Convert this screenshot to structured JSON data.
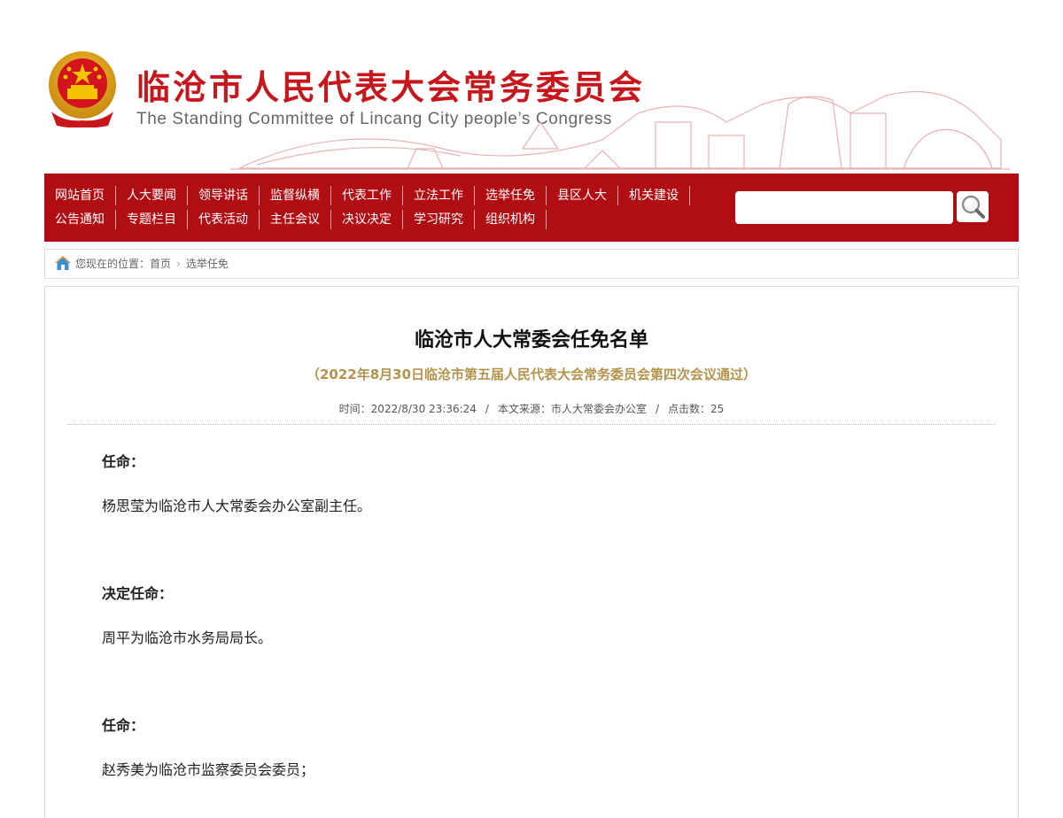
{
  "header": {
    "title_cn": "临沧市人民代表大会常务委员会",
    "title_en": "The Standing Committee of Lincang City people’s Congress",
    "emblem_icon": "national-emblem-icon"
  },
  "colors": {
    "brand_red": "#b10e14",
    "subtitle_gold": "#b3934a"
  },
  "nav": {
    "row1": [
      "网站首页",
      "人大要闻",
      "领导讲话",
      "监督纵横",
      "代表工作",
      "立法工作",
      "选举任免",
      "县区人大",
      "机关建设"
    ],
    "row2": [
      "公告通知",
      "专题栏目",
      "代表活动",
      "主任会议",
      "决议决定",
      "学习研究",
      "组织机构"
    ],
    "search_placeholder": "",
    "search_icon": "magnifier-icon"
  },
  "breadcrumb": {
    "prefix": "您现在的位置：",
    "items": [
      "首页",
      "选举任免"
    ]
  },
  "article": {
    "title": "临沧市人大常委会任免名单",
    "subtitle": "（2022年8月30日临沧市第五届人民代表大会常务委员会第四次会议通过）",
    "meta": {
      "time": "时间：2022/8/30 23:36:24",
      "source": "本文来源：市人大常委会办公室",
      "clicks": "点击数：25"
    },
    "paragraphs": [
      "任命：",
      "杨思莹为临沧市人大常委会办公室副主任。",
      "决定任命：",
      "周平为临沧市水务局局长。",
      "任命：",
      "赵秀美为临沧市监察委员会委员；"
    ]
  }
}
